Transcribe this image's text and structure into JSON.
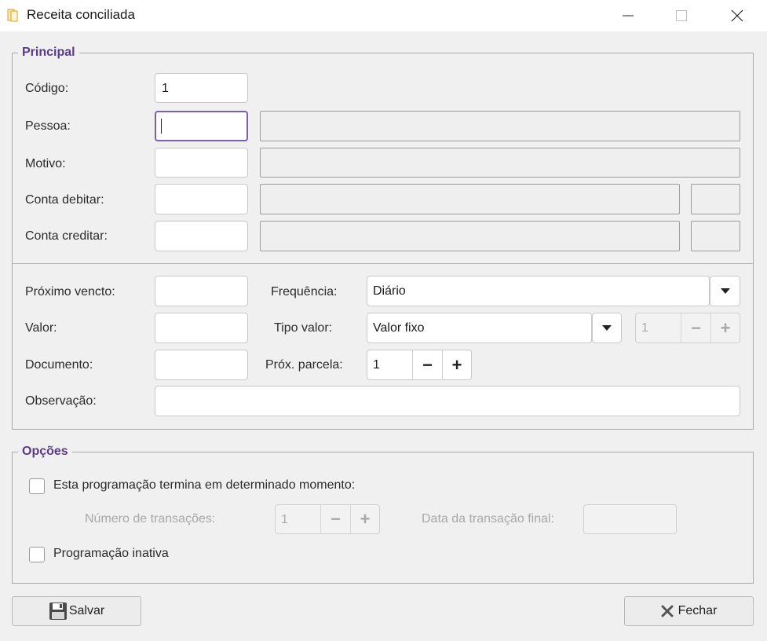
{
  "window": {
    "title": "Receita conciliada"
  },
  "principal": {
    "legend": "Principal",
    "codigo_label": "Código:",
    "codigo_value": "1",
    "pessoa_label": "Pessoa:",
    "motivo_label": "Motivo:",
    "conta_debitar_label": "Conta debitar:",
    "conta_creditar_label": "Conta creditar:",
    "proximo_vencto_label": "Próximo vencto:",
    "valor_label": "Valor:",
    "documento_label": "Documento:",
    "observacao_label": "Observação:",
    "frequencia_label": "Frequência:",
    "frequencia_value": "Diário",
    "tipo_valor_label": "Tipo valor:",
    "tipo_valor_value": "Valor fixo",
    "tipo_valor_spin_value": "1",
    "prox_parcela_label": "Próx. parcela:",
    "prox_parcela_value": "1"
  },
  "opcoes": {
    "legend": "Opções",
    "termina_label": "Esta programação termina em determinado momento:",
    "num_transacoes_label": "Número de transações:",
    "num_transacoes_value": "1",
    "data_final_label": "Data da transação final:",
    "inativa_label": "Programação inativa"
  },
  "buttons": {
    "salvar": "Salvar",
    "fechar": "Fechar"
  },
  "colors": {
    "accent": "#5a3a8a",
    "focus": "#7a5fb5",
    "background": "#f0f0f0"
  }
}
